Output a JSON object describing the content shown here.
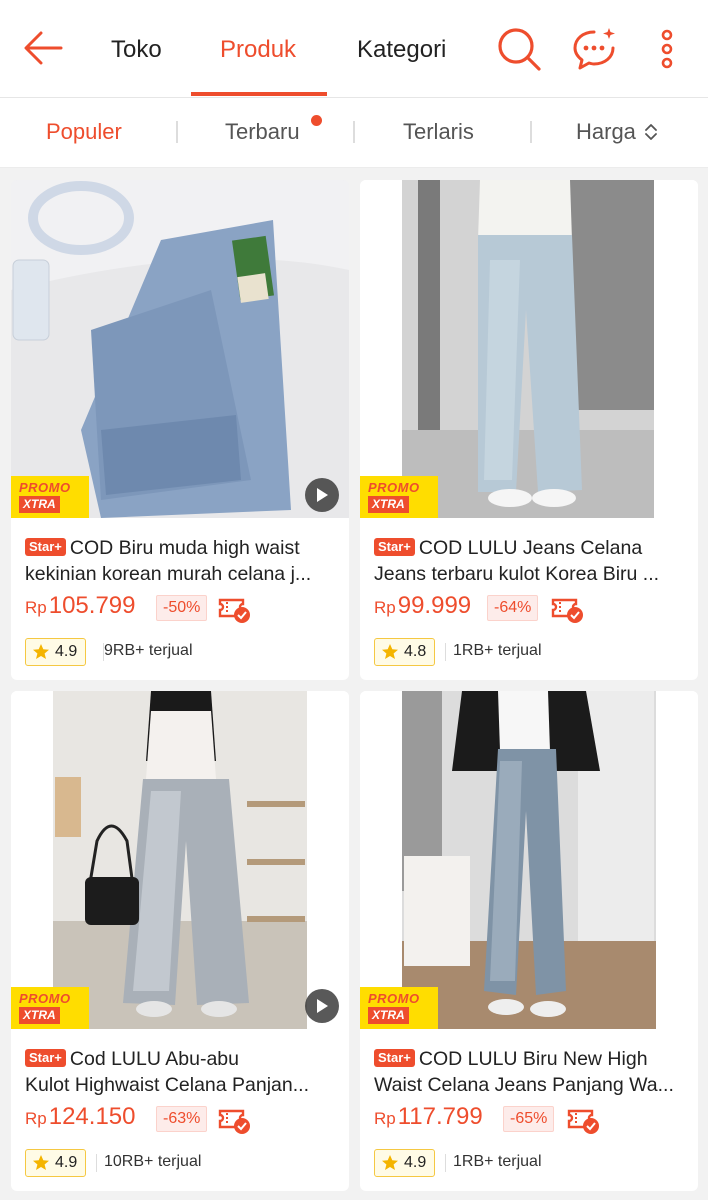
{
  "header": {
    "tabs": [
      {
        "label": "Toko"
      },
      {
        "label": "Produk"
      },
      {
        "label": "Kategori"
      }
    ]
  },
  "sort": {
    "options": [
      {
        "label": "Populer"
      },
      {
        "label": "Terbaru"
      },
      {
        "label": "Terlaris"
      },
      {
        "label": "Harga"
      }
    ]
  },
  "colors": {
    "accent": "#ee4d2d",
    "promo_bg": "#ffdd00"
  },
  "products": [
    {
      "badge": "Star+",
      "title_line1": "COD Biru muda high waist",
      "title_line2": "kekinian korean murah celana j...",
      "currency": "Rp",
      "price": "105.799",
      "discount": "-50%",
      "rating": "4.9",
      "sold": "9RB+ terjual",
      "promo_top": "PROMO",
      "promo_bottom": "XTRA",
      "has_video": true
    },
    {
      "badge": "Star+",
      "title_line1": "COD LULU Jeans Celana",
      "title_line2": "Jeans terbaru kulot Korea Biru ...",
      "currency": "Rp",
      "price": "99.999",
      "discount": "-64%",
      "rating": "4.8",
      "sold": "1RB+ terjual",
      "promo_top": "PROMO",
      "promo_bottom": "XTRA",
      "has_video": false
    },
    {
      "badge": "Star+",
      "title_line1": "Cod LULU Abu-abu",
      "title_line2": "Kulot Highwaist Celana Panjan...",
      "currency": "Rp",
      "price": "124.150",
      "discount": "-63%",
      "rating": "4.9",
      "sold": "10RB+ terjual",
      "promo_top": "PROMO",
      "promo_bottom": "XTRA",
      "has_video": true
    },
    {
      "badge": "Star+",
      "title_line1": "COD LULU Biru New High",
      "title_line2": "Waist Celana Jeans Panjang Wa...",
      "currency": "Rp",
      "price": "117.799",
      "discount": "-65%",
      "rating": "4.9",
      "sold": "1RB+ terjual",
      "promo_top": "PROMO",
      "promo_bottom": "XTRA",
      "has_video": false
    }
  ]
}
